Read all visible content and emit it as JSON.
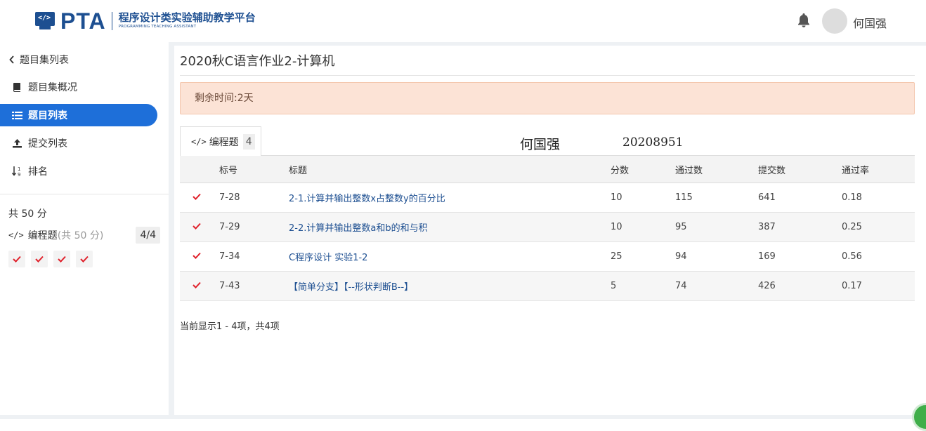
{
  "header": {
    "logo_text": "PTA",
    "logo_subtitle_cn": "程序设计类实验辅助教学平台",
    "logo_subtitle_en": "PROGRAMMING TEACHING ASSISTANT",
    "username": "何国强"
  },
  "sidebar": {
    "back_label": "题目集列表",
    "items": [
      {
        "label": "题目集概况",
        "icon": "book-icon"
      },
      {
        "label": "题目列表",
        "icon": "list-icon",
        "active": true
      },
      {
        "label": "提交列表",
        "icon": "upload-icon"
      },
      {
        "label": "排名",
        "icon": "sort-icon"
      }
    ],
    "total_score": "共 50 分",
    "category": {
      "name": "编程题",
      "score": "(共 50 分)",
      "count": "4/4"
    },
    "statuses": [
      "pass",
      "pass",
      "pass",
      "pass"
    ]
  },
  "main": {
    "title": "2020秋C语言作业2-计算机",
    "remaining_time": "剩余时间:2天",
    "tab": {
      "label": "编程题",
      "count": "4"
    },
    "watermark": {
      "name": "何国强",
      "id": "20208951"
    },
    "columns": [
      "标号",
      "标题",
      "分数",
      "通过数",
      "提交数",
      "通过率"
    ],
    "rows": [
      {
        "status": "pass",
        "id": "7-28",
        "title": "2-1.计算并输出整数x占整数y的百分比",
        "score": "10",
        "passed": "115",
        "submitted": "641",
        "rate": "0.18"
      },
      {
        "status": "pass",
        "id": "7-29",
        "title": "2-2.计算并输出整数a和b的和与积",
        "score": "10",
        "passed": "95",
        "submitted": "387",
        "rate": "0.25"
      },
      {
        "status": "pass",
        "id": "7-34",
        "title": "C程序设计 实验1-2",
        "score": "25",
        "passed": "94",
        "submitted": "169",
        "rate": "0.56"
      },
      {
        "status": "pass",
        "id": "7-43",
        "title": "【简单分支】【--形状判断B--】",
        "score": "5",
        "passed": "74",
        "submitted": "426",
        "rate": "0.17"
      }
    ],
    "footer": "当前显示1 - 4项，共4项"
  },
  "colors": {
    "accent": "#1e6fd9",
    "brand": "#1d4f91",
    "check": "#e0212b",
    "alert_bg": "#fce3d6"
  }
}
